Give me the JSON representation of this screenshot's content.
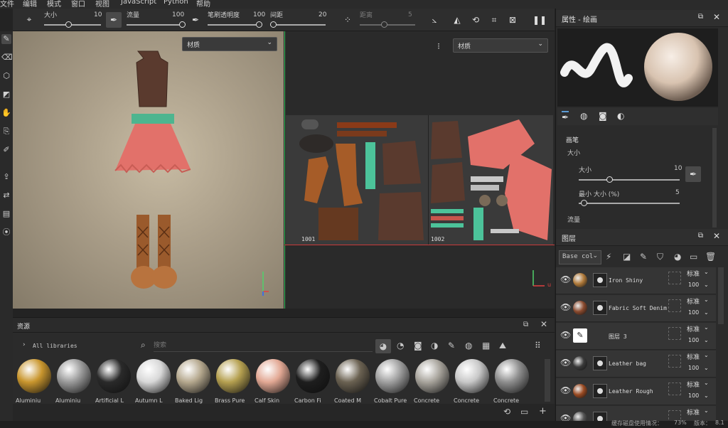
{
  "menu": [
    "文件",
    "编辑",
    "模式",
    "窗口",
    "视图",
    "JavaScript",
    "Python",
    "帮助"
  ],
  "toolbar": {
    "size_label": "大小",
    "size_value": "10",
    "flow_label": "流量",
    "flow_value": "100",
    "stroke_opacity_label": "笔刷透明度",
    "stroke_opacity_value": "100",
    "spacing_label": "间距",
    "spacing_value": "20",
    "distance_label": "距离",
    "distance_value": "5",
    "size_fraction": 0.42,
    "flow_fraction": 1.0,
    "opacity_fraction": 1.0,
    "spacing_fraction": 0.05
  },
  "viewport3d": {
    "material_dropdown": "材质",
    "axes": "y"
  },
  "viewport2d": {
    "material_dropdown": "材质",
    "uv_tile_1": "1001",
    "uv_tile_2": "1002",
    "axes": "u"
  },
  "properties": {
    "title": "属性 - 绘画",
    "brush_section": "画笔",
    "size_label": "大小",
    "size_sub_label": "大小",
    "size_value": "10",
    "size_fraction": 0.3,
    "min_size_label": "最小 大小 (%)",
    "min_size_value": "5",
    "min_size_fraction": 0.05,
    "flow_label": "流量"
  },
  "layers": {
    "title": "图层",
    "channel": "Base col",
    "items": [
      {
        "name": "Iron Shiny",
        "blend": "标准",
        "opacity": "100",
        "thumb": "#b07a3a"
      },
      {
        "name": "Fabric Soft Denim",
        "blend": "标准",
        "opacity": "100",
        "thumb": "#8a4a2e"
      },
      {
        "name": "图层 3",
        "blend": "标准",
        "opacity": "100",
        "thumb": "brush"
      },
      {
        "name": "Leather bag",
        "blend": "标准",
        "opacity": "100",
        "thumb": "#3a3a3a"
      },
      {
        "name": "Leather Rough",
        "blend": "标准",
        "opacity": "100",
        "thumb": "#9a4a22"
      },
      {
        "name": "",
        "blend": "标准",
        "opacity": "",
        "thumb": "#555"
      }
    ]
  },
  "assets": {
    "title": "资源",
    "library": "All libraries",
    "search_placeholder": "搜索",
    "materials": [
      {
        "name": "Aluminiu",
        "color": "#c9962e"
      },
      {
        "name": "Aluminiu",
        "color": "#9a9a9a"
      },
      {
        "name": "Artificial L",
        "color": "#2a2a2a"
      },
      {
        "name": "Autumn L",
        "color": "#d8d8d8"
      },
      {
        "name": "Baked Lig",
        "color": "#b5a88e"
      },
      {
        "name": "Brass Pure",
        "color": "#b5a050"
      },
      {
        "name": "Calf Skin",
        "color": "#e2a894"
      },
      {
        "name": "Carbon Fi",
        "color": "#1e1e1e"
      },
      {
        "name": "Coated M",
        "color": "#6b6252"
      },
      {
        "name": "Cobalt Pure",
        "color": "#a0a0a0"
      },
      {
        "name": "Concrete",
        "color": "#a8a49c"
      },
      {
        "name": "Concrete",
        "color": "#c8c8c8"
      },
      {
        "name": "Concrete",
        "color": "#8e8e8e"
      }
    ]
  },
  "status": {
    "cache_label": "缓存磁盘使用情况：",
    "cache_value": "73%",
    "version_label": "版本：",
    "version_value": "8.1"
  }
}
